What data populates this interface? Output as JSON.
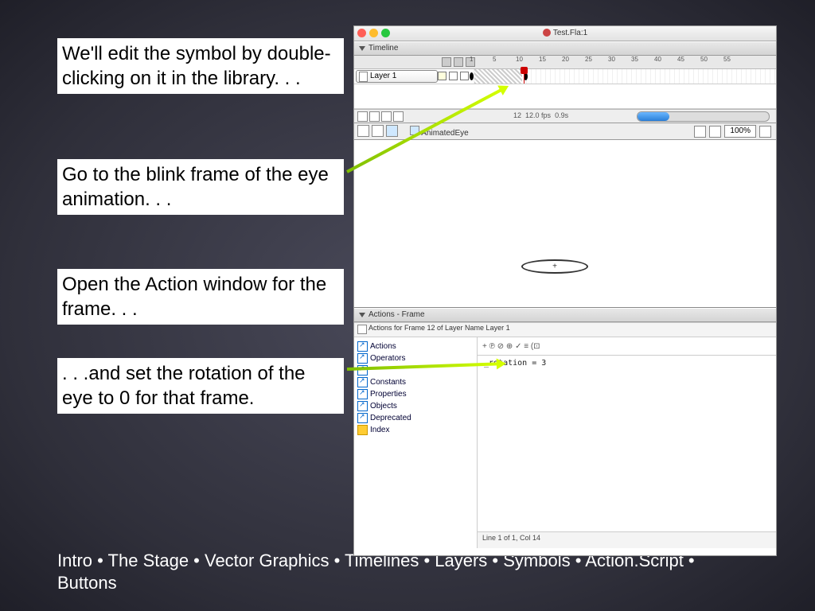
{
  "instructions": {
    "para1": "We'll edit the symbol by double-clicking on it in the library. . .",
    "para2": "Go to the blink frame of the eye animation. . .",
    "para3": "Open the Action window for the frame. . .",
    "para4": ". . .and set the rotation of the eye to 0 for that frame."
  },
  "footer": "Intro • The Stage • Vector Graphics • Timelines • Layers • Symbols • Action.Script • Buttons",
  "flash": {
    "window_title": "Test.Fla:1",
    "timeline_label": "Timeline",
    "ruler": [
      "1",
      "5",
      "10",
      "15",
      "20",
      "25",
      "30",
      "35",
      "40",
      "45",
      "50",
      "55"
    ],
    "layer_name": "Layer 1",
    "status": {
      "frame": "12",
      "fps": "12.0 fps",
      "time": "0.9s"
    },
    "edit_path": "AnimatedEye",
    "zoom": "100%",
    "actions": {
      "panel_title": "Actions - Frame",
      "subtitle": "Actions for Frame 12 of Layer Name Layer 1",
      "tree": [
        "Actions",
        "Operators",
        "",
        "Constants",
        "Properties",
        "Objects",
        "Deprecated",
        "Index"
      ],
      "toolbar_symbols": "+ ℗ ⊘ ⊕ ✓ ≡ (⊡",
      "code": "_rotation = 3",
      "code_status": "Line 1 of 1, Col 14"
    }
  }
}
